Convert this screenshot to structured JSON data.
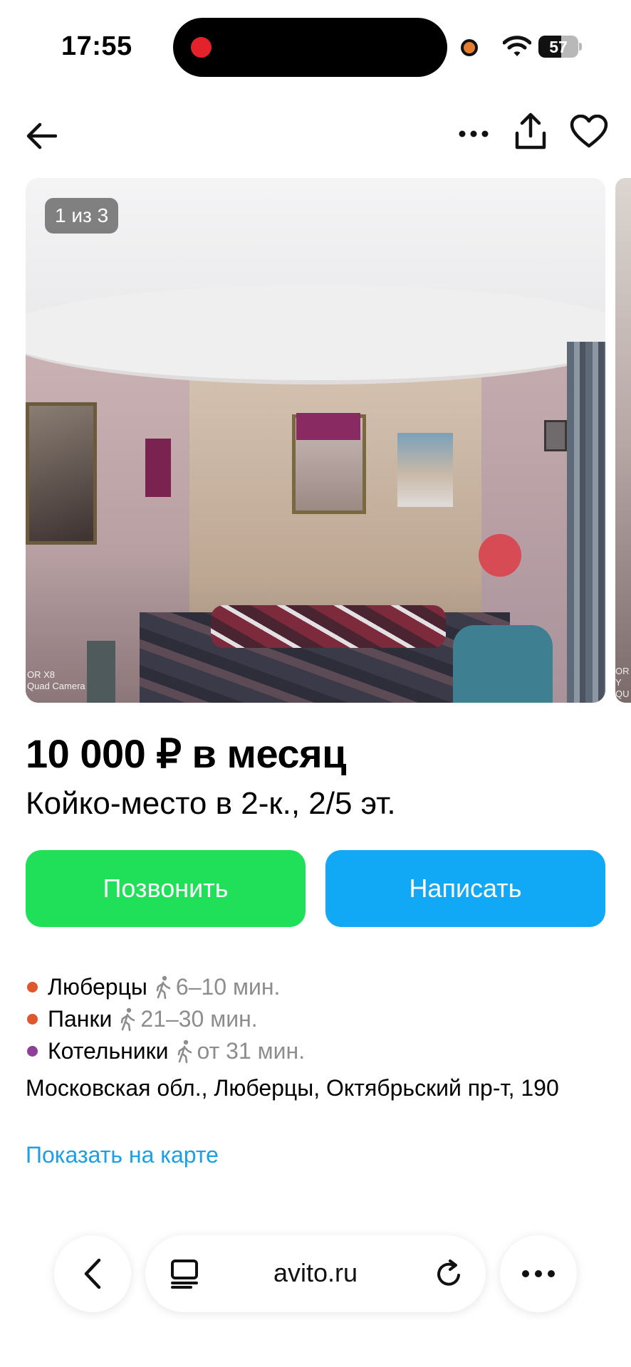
{
  "status_bar": {
    "time": "17:55",
    "battery_percent": "57",
    "battery_level": 0.57,
    "recording_color": "#e3222b",
    "camera_indicator_color": "#e57d2f"
  },
  "top_nav": {
    "back_icon": "arrow-left-icon",
    "more_icon": "more-horizontal-icon",
    "share_icon": "share-icon",
    "favorite_icon": "heart-outline-icon"
  },
  "gallery": {
    "counter": "1 из 3",
    "watermark_line1": "OR X8",
    "watermark_line2": "Quad Camera",
    "next_watermark_line1": "OR",
    "next_watermark_line2": "Y QU"
  },
  "listing": {
    "price": "10 000 ₽ в месяц",
    "title": "Койко-место в 2-к., 2/5 эт."
  },
  "actions": {
    "call_label": "Позвонить",
    "write_label": "Написать",
    "call_color": "#20e05a",
    "write_color": "#11a8f5"
  },
  "location": {
    "metro": [
      {
        "name": "Люберцы",
        "time": "6–10 мин.",
        "color": "#e0562f"
      },
      {
        "name": "Панки",
        "time": "21–30 мин.",
        "color": "#e0562f"
      },
      {
        "name": "Котельники",
        "time": "от 31 мин.",
        "color": "#8e3f97"
      }
    ],
    "address": "Московская обл., Люберцы, Октябрьский пр-т, 190",
    "map_link": "Показать на карте"
  },
  "browser": {
    "url": "avito.ru",
    "back_icon": "chevron-left-icon",
    "tabs_icon": "tabs-icon",
    "reload_icon": "reload-icon",
    "more_icon": "more-horizontal-icon"
  }
}
